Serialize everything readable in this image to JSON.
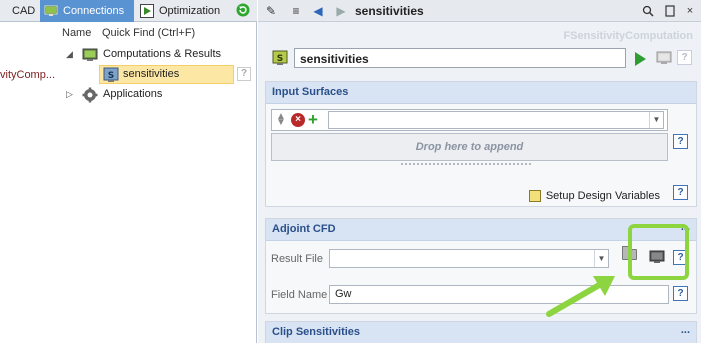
{
  "left_tabs": {
    "cad": "CAD",
    "connections": "Connections",
    "optimization": "Optimization"
  },
  "tree_header": {
    "name_col": "Name",
    "quick_find": "Quick Find (Ctrl+F)"
  },
  "tree": {
    "truncated_label": "vityComp...",
    "computations": "Computations & Results",
    "sensitivities": "sensitivities",
    "applications": "Applications"
  },
  "right_header": {
    "title": "sensitivities",
    "class_name": "FSensitivityComputation",
    "name_value": "sensitivities"
  },
  "input_surfaces": {
    "title": "Input Surfaces",
    "drop_hint": "Drop here to append",
    "setup_label": "Setup Design Variables"
  },
  "adjoint_cfd": {
    "title": "Adjoint CFD",
    "result_file_label": "Result File",
    "result_file_value": "",
    "field_name_label": "Field Name",
    "field_name_value": "Gw"
  },
  "clip_sensitivities": {
    "title": "Clip Sensitivities"
  },
  "symbols": {
    "help": "?",
    "more": "...",
    "remove": "×",
    "add": "+"
  },
  "colors": {
    "highlight": "#8cd440",
    "tab_active": "#5a93d2",
    "section_header": "#d8e4f3"
  }
}
